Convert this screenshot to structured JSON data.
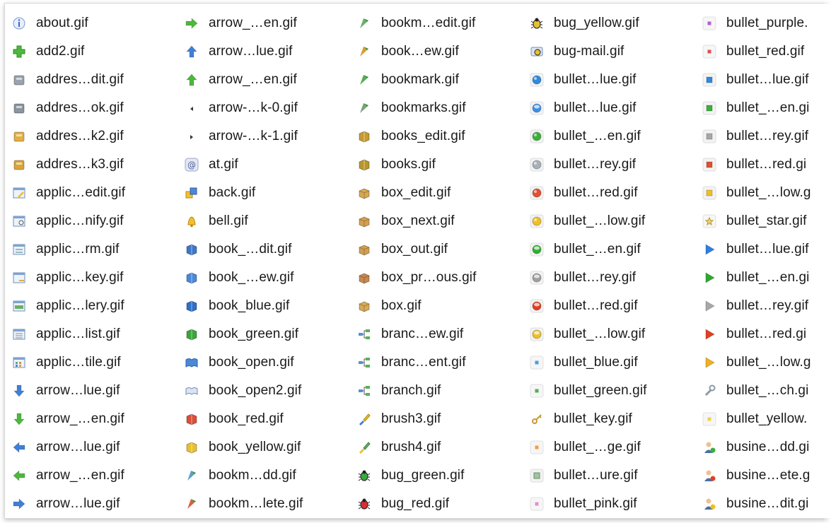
{
  "columns": [
    [
      {
        "label": "about.gif",
        "icon": "info-icon"
      },
      {
        "label": "add2.gif",
        "icon": "plus-icon"
      },
      {
        "label": "addres…dit.gif",
        "icon": "address-book-edit-icon"
      },
      {
        "label": "addres…ok.gif",
        "icon": "address-book-icon"
      },
      {
        "label": "addres…k2.gif",
        "icon": "address-book-2-icon"
      },
      {
        "label": "addres…k3.gif",
        "icon": "address-book-3-icon"
      },
      {
        "label": "applic…edit.gif",
        "icon": "application-edit-icon"
      },
      {
        "label": "applic…nify.gif",
        "icon": "application-magnify-icon"
      },
      {
        "label": "applic…rm.gif",
        "icon": "application-form-icon"
      },
      {
        "label": "applic…key.gif",
        "icon": "application-key-icon"
      },
      {
        "label": "applic…lery.gif",
        "icon": "application-gallery-icon"
      },
      {
        "label": "applic…list.gif",
        "icon": "application-list-icon"
      },
      {
        "label": "applic…tile.gif",
        "icon": "application-tile-icon"
      },
      {
        "label": "arrow…lue.gif",
        "icon": "arrow-down-blue-icon"
      },
      {
        "label": "arrow_…en.gif",
        "icon": "arrow-down-green-icon"
      },
      {
        "label": "arrow…lue.gif",
        "icon": "arrow-left-blue-icon"
      },
      {
        "label": "arrow_…en.gif",
        "icon": "arrow-left-green-icon"
      },
      {
        "label": "arrow…lue.gif",
        "icon": "arrow-right-blue-icon"
      }
    ],
    [
      {
        "label": "arrow_…en.gif",
        "icon": "arrow-right-green-icon"
      },
      {
        "label": "arrow…lue.gif",
        "icon": "arrow-up-blue-icon"
      },
      {
        "label": "arrow_…en.gif",
        "icon": "arrow-up-green-icon"
      },
      {
        "label": "arrow-…k-0.gif",
        "icon": "arrow-small-left-icon"
      },
      {
        "label": "arrow-…k-1.gif",
        "icon": "arrow-small-right-icon"
      },
      {
        "label": "at.gif",
        "icon": "at-sign-icon"
      },
      {
        "label": "back.gif",
        "icon": "back-icon"
      },
      {
        "label": "bell.gif",
        "icon": "bell-icon"
      },
      {
        "label": "book_…dit.gif",
        "icon": "book-edit-icon"
      },
      {
        "label": "book_…ew.gif",
        "icon": "book-view-icon"
      },
      {
        "label": "book_blue.gif",
        "icon": "book-blue-icon"
      },
      {
        "label": "book_green.gif",
        "icon": "book-green-icon"
      },
      {
        "label": "book_open.gif",
        "icon": "book-open-icon"
      },
      {
        "label": "book_open2.gif",
        "icon": "book-open-2-icon"
      },
      {
        "label": "book_red.gif",
        "icon": "book-red-icon"
      },
      {
        "label": "book_yellow.gif",
        "icon": "book-yellow-icon"
      },
      {
        "label": "bookm…dd.gif",
        "icon": "bookmark-add-icon"
      },
      {
        "label": "bookm…lete.gif",
        "icon": "bookmark-delete-icon"
      }
    ],
    [
      {
        "label": "bookm…edit.gif",
        "icon": "bookmark-edit-icon"
      },
      {
        "label": "book…ew.gif",
        "icon": "bookmark-view-icon"
      },
      {
        "label": "bookmark.gif",
        "icon": "bookmark-icon"
      },
      {
        "label": "bookmarks.gif",
        "icon": "bookmarks-icon"
      },
      {
        "label": "books_edit.gif",
        "icon": "books-edit-icon"
      },
      {
        "label": "books.gif",
        "icon": "books-icon"
      },
      {
        "label": "box_edit.gif",
        "icon": "box-edit-icon"
      },
      {
        "label": "box_next.gif",
        "icon": "box-next-icon"
      },
      {
        "label": "box_out.gif",
        "icon": "box-out-icon"
      },
      {
        "label": "box_pr…ous.gif",
        "icon": "box-previous-icon"
      },
      {
        "label": "box.gif",
        "icon": "box-icon"
      },
      {
        "label": "branc…ew.gif",
        "icon": "branch-view-icon"
      },
      {
        "label": "branc…ent.gif",
        "icon": "branch-element-icon"
      },
      {
        "label": "branch.gif",
        "icon": "branch-icon"
      },
      {
        "label": "brush3.gif",
        "icon": "brush-3-icon"
      },
      {
        "label": "brush4.gif",
        "icon": "brush-4-icon"
      },
      {
        "label": "bug_green.gif",
        "icon": "bug-green-icon"
      },
      {
        "label": "bug_red.gif",
        "icon": "bug-red-icon"
      }
    ],
    [
      {
        "label": "bug_yellow.gif",
        "icon": "bug-yellow-icon"
      },
      {
        "label": "bug-mail.gif",
        "icon": "bug-mail-icon"
      },
      {
        "label": "bullet…lue.gif",
        "icon": "bullet-ball-blue-icon"
      },
      {
        "label": "bullet…lue.gif",
        "icon": "bullet-ball-glass-blue-icon"
      },
      {
        "label": "bullet_…en.gif",
        "icon": "bullet-ball-green-icon"
      },
      {
        "label": "bullet…rey.gif",
        "icon": "bullet-ball-grey-icon"
      },
      {
        "label": "bullet…red.gif",
        "icon": "bullet-ball-red-icon"
      },
      {
        "label": "bullet_…low.gif",
        "icon": "bullet-ball-yellow-icon"
      },
      {
        "label": "bullet_…en.gif",
        "icon": "bullet-ball-glass-green-icon"
      },
      {
        "label": "bullet…rey.gif",
        "icon": "bullet-ball-glass-grey-icon"
      },
      {
        "label": "bullet…red.gif",
        "icon": "bullet-ball-glass-red-icon"
      },
      {
        "label": "bullet_…low.gif",
        "icon": "bullet-ball-glass-yellow-icon"
      },
      {
        "label": "bullet_blue.gif",
        "icon": "bullet-blue-icon"
      },
      {
        "label": "bullet_green.gif",
        "icon": "bullet-green-icon"
      },
      {
        "label": "bullet_key.gif",
        "icon": "bullet-key-icon"
      },
      {
        "label": "bullet_…ge.gif",
        "icon": "bullet-orange-icon"
      },
      {
        "label": "bullet…ure.gif",
        "icon": "bullet-picture-icon"
      },
      {
        "label": "bullet_pink.gif",
        "icon": "bullet-pink-icon"
      }
    ],
    [
      {
        "label": "bullet_purple.",
        "icon": "bullet-purple-icon"
      },
      {
        "label": "bullet_red.gif",
        "icon": "bullet-red-icon"
      },
      {
        "label": "bullet…lue.gif",
        "icon": "bullet-square-blue-icon"
      },
      {
        "label": "bullet_…en.gi",
        "icon": "bullet-square-green-icon"
      },
      {
        "label": "bullet…rey.gif",
        "icon": "bullet-square-grey-icon"
      },
      {
        "label": "bullet…red.gi",
        "icon": "bullet-square-red-icon"
      },
      {
        "label": "bullet_…low.g",
        "icon": "bullet-square-yellow-icon"
      },
      {
        "label": "bullet_star.gif",
        "icon": "bullet-star-icon"
      },
      {
        "label": "bullet…lue.gif",
        "icon": "bullet-triangle-blue-icon"
      },
      {
        "label": "bullet_…en.gi",
        "icon": "bullet-triangle-green-icon"
      },
      {
        "label": "bullet…rey.gif",
        "icon": "bullet-triangle-grey-icon"
      },
      {
        "label": "bullet…red.gi",
        "icon": "bullet-triangle-red-icon"
      },
      {
        "label": "bullet_…low.g",
        "icon": "bullet-triangle-yellow-icon"
      },
      {
        "label": "bullet_…ch.gi",
        "icon": "bullet-wrench-icon"
      },
      {
        "label": "bullet_yellow.",
        "icon": "bullet-yellow-icon"
      },
      {
        "label": "busine…dd.gi",
        "icon": "businessman-add-icon"
      },
      {
        "label": "busine…ete.g",
        "icon": "businessman-delete-icon"
      },
      {
        "label": "busine…dit.gi",
        "icon": "businessman-edit-icon"
      }
    ]
  ]
}
